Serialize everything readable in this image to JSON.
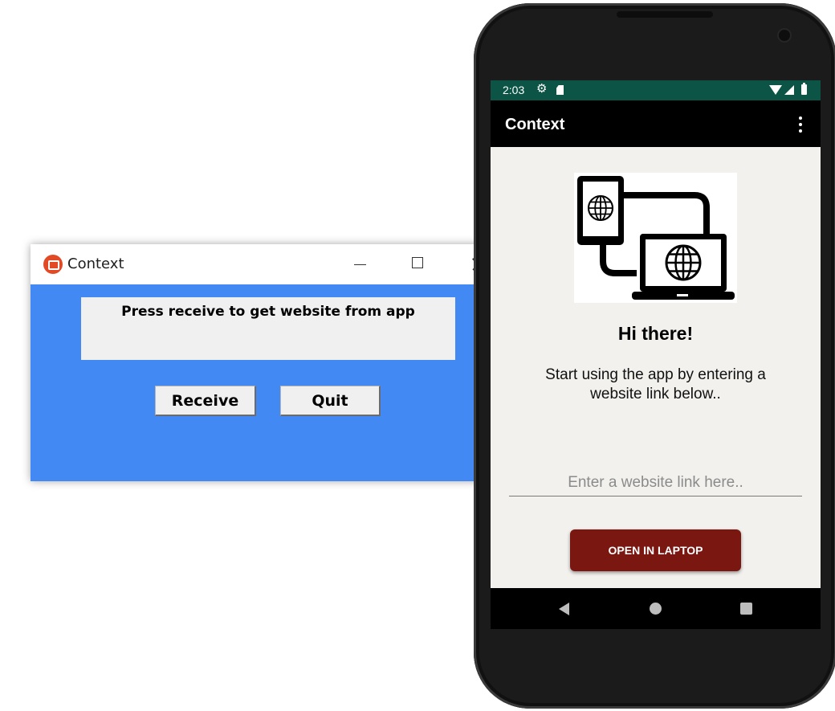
{
  "desktop_window": {
    "title": "Context",
    "icon": "app-logo-icon",
    "controls": [
      "minimize-icon",
      "maximize-icon",
      "close-icon"
    ],
    "background_color": "#4289f3",
    "message": "Press receive to get website from app",
    "buttons": {
      "receive": "Receive",
      "quit": "Quit"
    }
  },
  "phone": {
    "status_bar": {
      "time": "2:03",
      "left_icons": [
        "gear-icon",
        "sd-card-icon"
      ],
      "right_icons": [
        "wifi-icon",
        "signal-icon",
        "battery-icon"
      ],
      "color": "#0b5446"
    },
    "app_bar": {
      "title": "Context",
      "menu_icon": "overflow-menu-icon"
    },
    "hero_icon": "devices-globe-icon",
    "greeting": "Hi there!",
    "intro": "Start using the app by entering a website link below..",
    "link_input": {
      "placeholder": "Enter a website link here..",
      "value": ""
    },
    "open_button": {
      "label": "OPEN IN LAPTOP",
      "color": "#7b1711"
    },
    "nav_bar": [
      "back-icon",
      "home-icon",
      "recents-icon"
    ]
  }
}
